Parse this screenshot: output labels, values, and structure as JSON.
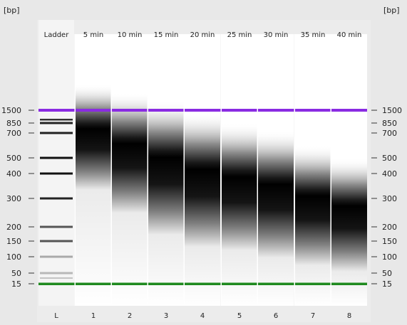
{
  "axis_unit": "[bp]",
  "ladder_label": "Ladder",
  "lanes": [
    {
      "header": "Ladder",
      "footer": "L",
      "type": "ladder"
    },
    {
      "header": "5 min",
      "footer": "1",
      "peak_bp": 1000,
      "spread": 0.3
    },
    {
      "header": "10 min",
      "footer": "2",
      "peak_bp": 680,
      "spread": 0.34
    },
    {
      "header": "15 min",
      "footer": "3",
      "peak_bp": 560,
      "spread": 0.38
    },
    {
      "header": "20 min",
      "footer": "4",
      "peak_bp": 470,
      "spread": 0.38
    },
    {
      "header": "25 min",
      "footer": "5",
      "peak_bp": 420,
      "spread": 0.36
    },
    {
      "header": "30 min",
      "footer": "6",
      "peak_bp": 380,
      "spread": 0.36
    },
    {
      "header": "35 min",
      "footer": "7",
      "peak_bp": 330,
      "spread": 0.34
    },
    {
      "header": "40 min",
      "footer": "8",
      "peak_bp": 290,
      "spread": 0.32
    }
  ],
  "ticks": [
    "1500",
    "850",
    "700",
    "500",
    "400",
    "300",
    "200",
    "150",
    "100",
    "50",
    "15"
  ],
  "marker_upper": {
    "bp": "1500",
    "color": "#8a2be2"
  },
  "marker_lower": {
    "bp": "15",
    "color": "#1f8a1f"
  },
  "colors": {
    "background": "#e8e8e8",
    "lane": "#ffffff",
    "band": "#000000",
    "ladder_band": "#111111"
  }
}
